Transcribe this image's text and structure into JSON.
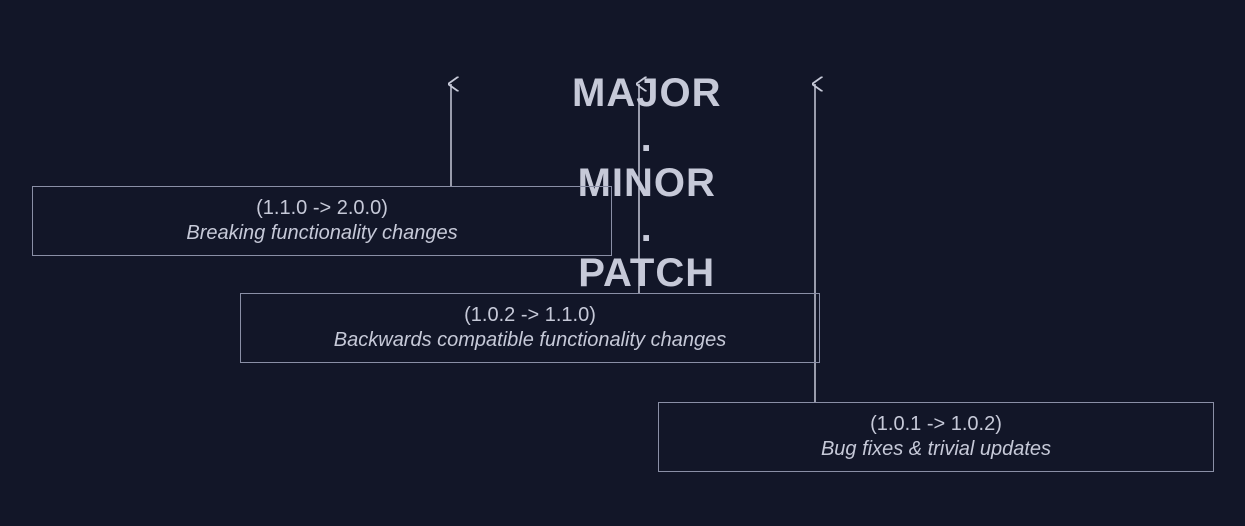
{
  "heading": {
    "major": "MAJOR",
    "minor": "MINOR",
    "patch": "PATCH",
    "sep": "."
  },
  "boxes": {
    "major": {
      "example": "(1.1.0 -> 2.0.0)",
      "desc": "Breaking functionality changes"
    },
    "minor": {
      "example": "(1.0.2 -> 1.1.0)",
      "desc": "Backwards compatible functionality changes"
    },
    "patch": {
      "example": "(1.0.1 -> 1.0.2)",
      "desc": "Bug fixes & trivial updates"
    }
  }
}
